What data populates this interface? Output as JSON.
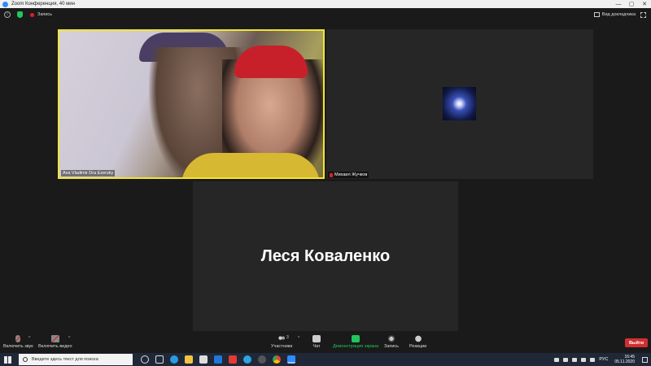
{
  "window": {
    "title": "Zoom Конференция, 40 мин",
    "controls": [
      "—",
      "▢",
      "✕"
    ]
  },
  "topbar": {
    "recording_label": "Запись",
    "view_label": "Вид докладчика"
  },
  "tiles": [
    {
      "name": "Ava Vladimir Dra Ezersky",
      "muted": false,
      "type": "video"
    },
    {
      "name": "Михаил Жучков",
      "muted": true,
      "type": "avatar"
    },
    {
      "name": "Леся Коваленко",
      "muted": false,
      "type": "name-only"
    }
  ],
  "toolbar": {
    "audio_label": "Включить звук",
    "video_label": "Включить видео",
    "participants_label": "Участники",
    "participants_count": "3",
    "chat_label": "Чат",
    "share_label": "Демонстрация экрана",
    "record_label": "Запись",
    "reactions_label": "Реакции",
    "end_label": "Выйти"
  },
  "taskbar": {
    "search_placeholder": "Введите здесь текст для поиска",
    "language": "РУС",
    "time": "16:45",
    "date": "05.11.2020"
  },
  "colors": {
    "active_speaker_border": "#f2e533",
    "end_button": "#d12f2f",
    "share_green": "#23c55e"
  }
}
